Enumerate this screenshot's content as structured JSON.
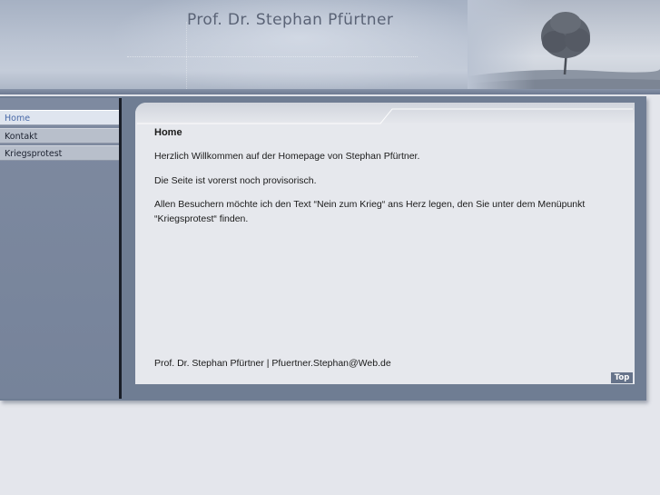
{
  "header": {
    "title": "Prof. Dr. Stephan Pfürtner"
  },
  "nav": {
    "items": [
      {
        "label": "Home",
        "active": true
      },
      {
        "label": "Kontakt",
        "active": false
      },
      {
        "label": "Kriegsprotest",
        "active": false
      }
    ]
  },
  "main": {
    "heading": "Home",
    "paragraphs": [
      "Herzlich Willkommen auf der Homepage von Stephan Pfürtner.",
      "Die Seite ist vorerst noch provisorisch.",
      "Allen Besuchern möchte ich den Text “Nein zum Krieg“ ans Herz legen, den Sie unter dem Menüpunkt",
      "“Kriegsprotest“ finden."
    ],
    "footer": "Prof. Dr. Stephan Pfürtner | Pfuertner.Stephan@Web.de",
    "top_label": "Top"
  },
  "colors": {
    "frame": "#6f7d93",
    "sidebar": "#7e8aa0",
    "content_bg": "#e6e8ed",
    "active_nav_text": "#4a6aa8"
  },
  "icons": {
    "header_image": "tree-landscape"
  }
}
